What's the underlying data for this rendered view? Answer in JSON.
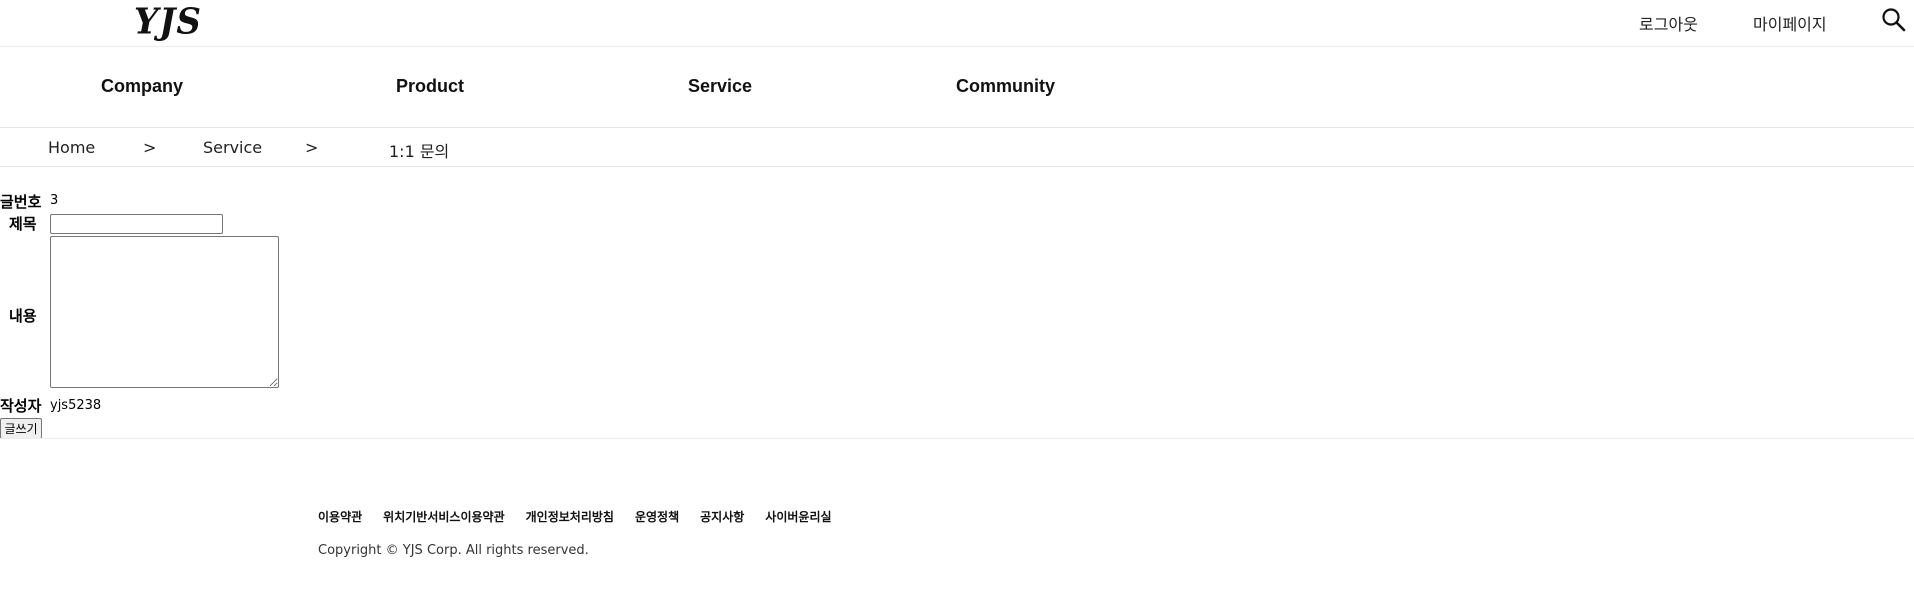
{
  "header": {
    "logo": "YJS",
    "logout_label": "로그아웃",
    "mypage_label": "마이페이지",
    "search_icon": "search-icon"
  },
  "gnb": {
    "items": [
      {
        "label": "Company"
      },
      {
        "label": "Product"
      },
      {
        "label": "Service"
      },
      {
        "label": "Community"
      }
    ]
  },
  "breadcrumb": {
    "home": "Home",
    "separator": ">",
    "section": "Service",
    "current": "1:1 문의"
  },
  "form": {
    "no_label": "글번호",
    "no_value": "3",
    "title_label": "제목",
    "title_value": "",
    "content_label": "내용",
    "content_value": "",
    "author_label": "작성자",
    "author_value": "yjs5238",
    "submit_label": "글쓰기"
  },
  "footer": {
    "links": [
      {
        "label": "이용약관"
      },
      {
        "label": "위치기반서비스이용약관"
      },
      {
        "label": "개인정보처리방침"
      },
      {
        "label": "운영정책"
      },
      {
        "label": "공지사항"
      },
      {
        "label": "사이버윤리실"
      }
    ],
    "copyright": "Copyright © YJS Corp. All rights reserved."
  }
}
